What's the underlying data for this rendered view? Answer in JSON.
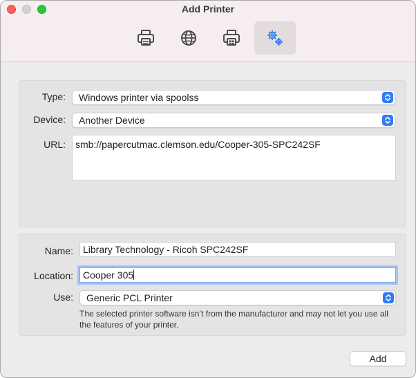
{
  "window": {
    "title": "Add Printer"
  },
  "toolbar": {
    "items": [
      {
        "icon": "printer-icon",
        "selected": false
      },
      {
        "icon": "globe-icon",
        "selected": false
      },
      {
        "icon": "windows-printer-icon",
        "selected": false
      },
      {
        "icon": "gears-icon",
        "selected": true
      }
    ]
  },
  "connection": {
    "type_label": "Type:",
    "type_value": "Windows printer via spoolss",
    "device_label": "Device:",
    "device_value": "Another Device",
    "url_label": "URL:",
    "url_value": "smb://papercutmac.clemson.edu/Cooper-305-SPC242SF"
  },
  "details": {
    "name_label": "Name:",
    "name_value": "Library Technology - Ricoh SPC242SF",
    "location_label": "Location:",
    "location_value": "Cooper 305",
    "use_label": "Use:",
    "use_value": "Generic PCL Printer",
    "warning": "The selected printer software isn’t from the manufacturer and may not let you use all the features of your printer."
  },
  "footer": {
    "add_label": "Add"
  },
  "colors": {
    "accent": "#2f7df6",
    "focus_ring": "#a5c4f3"
  }
}
